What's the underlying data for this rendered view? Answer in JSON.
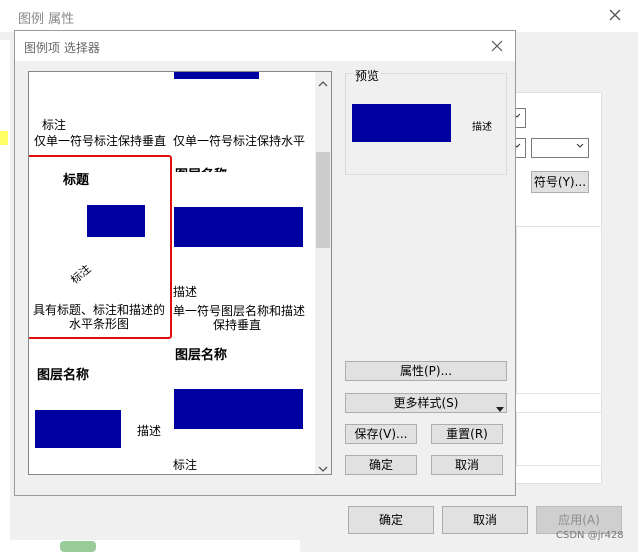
{
  "outer_window": {
    "title": "图例 属性",
    "symbol_button": "符号(Y)...",
    "ok": "确定",
    "cancel": "取消",
    "apply": "应用(A)"
  },
  "dialog": {
    "title": "图例项 选择器",
    "preview": {
      "label": "预览",
      "desc": "描述"
    },
    "properties_button": "属性(P)...",
    "more_styles_button": "更多样式(S)",
    "save_button": "保存(V)...",
    "reset_button": "重置(R)",
    "ok_button": "确定",
    "cancel_button": "取消"
  },
  "gallery": {
    "item_top_left": {
      "label": "标注",
      "caption": "仅单一符号标注保持垂直"
    },
    "item_top_right": {
      "caption": "仅单一符号标注保持水平"
    },
    "item_selected": {
      "heading": "标题",
      "label": "标注",
      "caption_line1": "具有标题、标注和描述的",
      "caption_line2": "水平条形图"
    },
    "item_mid_right": {
      "heading": "图层名称",
      "desc": "描述",
      "caption_line1": "单一符号图层名称和描述",
      "caption_line2": "保持垂直"
    },
    "item_bottom_left": {
      "heading": "图层名称",
      "desc": "描述"
    },
    "item_bottom_right": {
      "heading": "图层名称",
      "label": "标注"
    }
  },
  "watermark": "CSDN @jr428",
  "colors": {
    "swatch": "#0000a0",
    "selection": "#e01010"
  }
}
